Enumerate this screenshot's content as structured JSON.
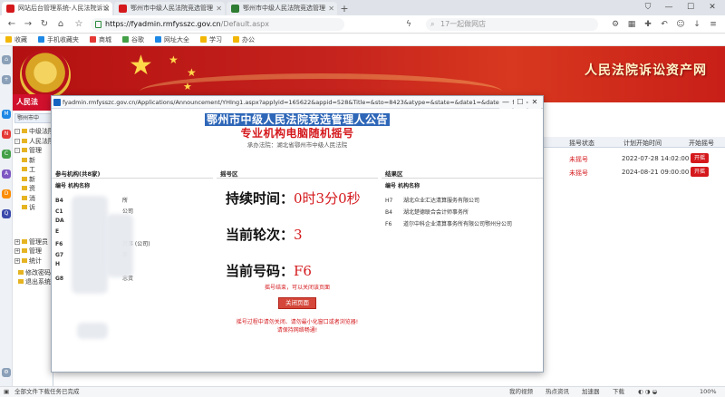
{
  "browser": {
    "tabs": [
      {
        "label": "网站后台管理系统-人民法院诉讼",
        "active": true,
        "fav_color": "#d4181c"
      },
      {
        "label": "鄂州市中级人民法院竞选管理",
        "active": false,
        "fav_color": "#d4181c"
      },
      {
        "label": "鄂州市中级人民法院竞选管理",
        "active": false,
        "fav_color": "#2e7d32"
      }
    ],
    "new_tab": "+",
    "url_host": "https://fyadmin.rmfysszc.gov.cn",
    "url_path": "/Default.aspx",
    "search_placeholder": "17一起做网店",
    "bookmarks": [
      {
        "label": "收藏",
        "color": "#f2b705"
      },
      {
        "label": "手机收藏夹",
        "color": "#1e88e5"
      },
      {
        "label": "商城",
        "color": "#e53935"
      },
      {
        "label": "谷歌",
        "color": "#43a047"
      },
      {
        "label": "网址大全",
        "color": "#1e88e5"
      },
      {
        "label": "学习",
        "color": "#f2b705"
      },
      {
        "label": "办公",
        "color": "#f2b705"
      }
    ]
  },
  "site": {
    "banner_title": "人民法院诉讼资产网",
    "app_header": "人民法",
    "breadcrumb": "鄂州市中",
    "tree": [
      {
        "label": "中级法院管",
        "toggle": "-"
      },
      {
        "label": "人民法院",
        "toggle": "-"
      },
      {
        "label": "管理",
        "toggle": "-"
      },
      {
        "label": "新",
        "toggle": ""
      },
      {
        "label": "工",
        "toggle": ""
      },
      {
        "label": "新",
        "toggle": ""
      },
      {
        "label": "资",
        "toggle": ""
      },
      {
        "label": "消",
        "toggle": ""
      },
      {
        "label": "诉",
        "toggle": ""
      },
      {
        "label": "管理员",
        "toggle": "+"
      },
      {
        "label": "管理",
        "toggle": "+"
      },
      {
        "label": "统计",
        "toggle": "+"
      },
      {
        "label": "修改密码",
        "toggle": ""
      },
      {
        "label": "退出系统",
        "toggle": ""
      }
    ],
    "table_headers": {
      "status": "摇号状态",
      "start_time": "计划开始时间",
      "start": "开始摇号"
    },
    "table_rows": [
      {
        "status": "未摇号",
        "time": "2022-07-28 14:02:00",
        "btn": "开摇"
      },
      {
        "status": "未摇号",
        "time": "2024-08-21 09:00:00",
        "btn": "开摇"
      }
    ]
  },
  "popup": {
    "url": "fyadmin.rmfysszc.gov.cn/Applications/Announcement/YHIng1.aspx?applyid=165622&appid=528&Title=&sto=8423&atype=&state=&date1=&date2=&flag=0",
    "title": "鄂州市中级人民法院竞选管理人公告",
    "subtitle": "专业机构电脑随机摇号",
    "court_line": "承办法院：湖北省鄂州市中级人民法院",
    "left": {
      "label": "参与机构(共8家)",
      "header": "编号   机构名称",
      "rows": [
        {
          "code": "B4",
          "name": "所"
        },
        {
          "code": "C1",
          "name": "公司"
        },
        {
          "code": "DA",
          "name": ""
        },
        {
          "code": "E",
          "name": ""
        },
        {
          "code": "F6",
          "name": "算事 (公司)"
        },
        {
          "code": "G7",
          "name": "事"
        },
        {
          "code": "H",
          "name": ""
        },
        {
          "code": "G8",
          "name": "忠责"
        }
      ]
    },
    "center": {
      "label": "摇号区",
      "duration_label": "持续时间：",
      "duration_value": "0时3分0秒",
      "round_label": "当前轮次：",
      "round_value": "3",
      "code_label": "当前号码：",
      "code_value": "F6",
      "notice1": "摇号结束，可以关闭该页面",
      "close_button": "关闭页面",
      "notice2": "摇号过程中请勿关闭、请勿最小化窗口或者浏览器!",
      "notice3": "请保持网络畅通!"
    },
    "right": {
      "label": "结果区",
      "header": "编号   机构名称",
      "rows": [
        {
          "code": "H7",
          "name": "湖北众业汇达清算服务有限公司"
        },
        {
          "code": "B4",
          "name": "湖北楚德联合会计师事务所"
        },
        {
          "code": "F6",
          "name": "道尔中科企业清算事务所有限公司鄂州分公司"
        }
      ]
    }
  },
  "statusbar": {
    "left": "全部文件下载任务已完成",
    "right_items": [
      "我的视频",
      "热点资讯",
      "加速器",
      "下载",
      "100%"
    ]
  },
  "colors": {
    "accent_red": "#d4181c",
    "title_blue": "#2f67b8",
    "banner_red": "#c5231d"
  }
}
